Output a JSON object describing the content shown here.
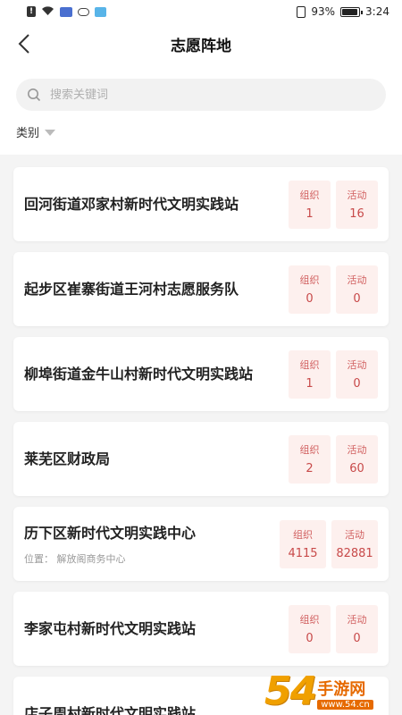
{
  "status_bar": {
    "battery": "93%",
    "time": "3:24",
    "battery_fraction": 0.93
  },
  "header": {
    "title": "志愿阵地"
  },
  "search": {
    "placeholder": "搜索关键词",
    "value": ""
  },
  "filter": {
    "label": "类别"
  },
  "cards": [
    {
      "title": "回河街道邓家村新时代文明实践站",
      "address": "",
      "org_label": "组织",
      "org_count": "1",
      "act_label": "活动",
      "act_count": "16"
    },
    {
      "title": "起步区崔寨街道王河村志愿服务队",
      "address": "",
      "org_label": "组织",
      "org_count": "0",
      "act_label": "活动",
      "act_count": "0"
    },
    {
      "title": "柳埠街道金牛山村新时代文明实践站",
      "address": "",
      "org_label": "组织",
      "org_count": "1",
      "act_label": "活动",
      "act_count": "0"
    },
    {
      "title": "莱芜区财政局",
      "address": "",
      "org_label": "组织",
      "org_count": "2",
      "act_label": "活动",
      "act_count": "60"
    },
    {
      "title": "历下区新时代文明实践中心",
      "address": "位置： 解放阁商务中心",
      "org_label": "组织",
      "org_count": "4115",
      "act_label": "活动",
      "act_count": "82881"
    },
    {
      "title": "李家屯村新时代文明实践站",
      "address": "",
      "org_label": "组织",
      "org_count": "0",
      "act_label": "活动",
      "act_count": "0"
    },
    {
      "title": "店子周村新时代文明实践站",
      "address": "",
      "org_label": "",
      "org_count": "",
      "act_label": "",
      "act_count": ""
    }
  ],
  "watermark": {
    "number": "54",
    "site_name": "手游网",
    "url": "www.54.cn"
  },
  "colors": {
    "accent": "#c84a4a",
    "stat_bg": "#fdf0ee",
    "page_bg": "#f4f4f4"
  }
}
